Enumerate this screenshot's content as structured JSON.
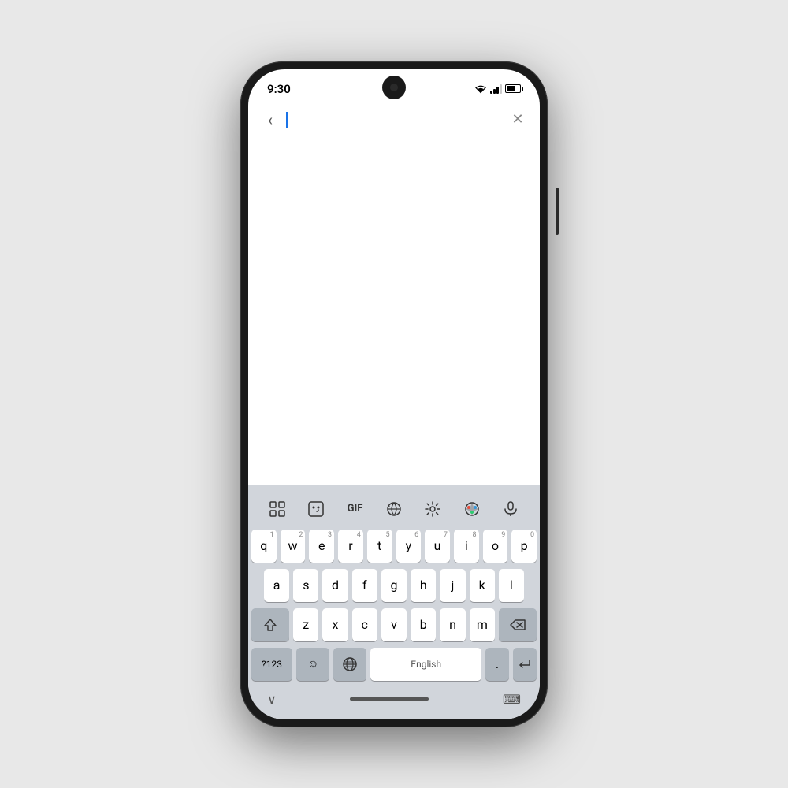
{
  "device": {
    "time": "9:30"
  },
  "statusBar": {
    "time": "9:30",
    "wifi": true,
    "signal_bars": [
      4,
      7,
      10,
      13
    ],
    "battery_level": 70
  },
  "searchBar": {
    "back_label": "‹",
    "close_label": "✕",
    "placeholder": ""
  },
  "keyboard": {
    "toolbar": {
      "apps_icon": "⊞",
      "emoji_icon": "☺",
      "gif_label": "GIF",
      "translate_icon": "⊕",
      "settings_icon": "⚙",
      "theme_icon": "🎨",
      "mic_icon": "🎤"
    },
    "rows": [
      {
        "keys": [
          {
            "letter": "q",
            "number": "1"
          },
          {
            "letter": "w",
            "number": "2"
          },
          {
            "letter": "e",
            "number": "3"
          },
          {
            "letter": "r",
            "number": "4"
          },
          {
            "letter": "t",
            "number": "5"
          },
          {
            "letter": "y",
            "number": "6"
          },
          {
            "letter": "u",
            "number": "7"
          },
          {
            "letter": "i",
            "number": "8"
          },
          {
            "letter": "o",
            "number": "9"
          },
          {
            "letter": "p",
            "number": "0"
          }
        ]
      },
      {
        "keys": [
          {
            "letter": "a"
          },
          {
            "letter": "s"
          },
          {
            "letter": "d"
          },
          {
            "letter": "f"
          },
          {
            "letter": "g"
          },
          {
            "letter": "h"
          },
          {
            "letter": "j"
          },
          {
            "letter": "k"
          },
          {
            "letter": "l"
          }
        ]
      }
    ],
    "row3": [
      "z",
      "x",
      "c",
      "v",
      "b",
      "n",
      "m"
    ],
    "bottom": {
      "symbol_label": "?123",
      "emoji_label": "☺,",
      "globe_label": "🌐",
      "space_label": "English",
      "period_label": ".",
      "enter_label": "↵"
    }
  },
  "bottomNav": {
    "chevron_down": "∨",
    "keyboard_icon": "⌨"
  }
}
